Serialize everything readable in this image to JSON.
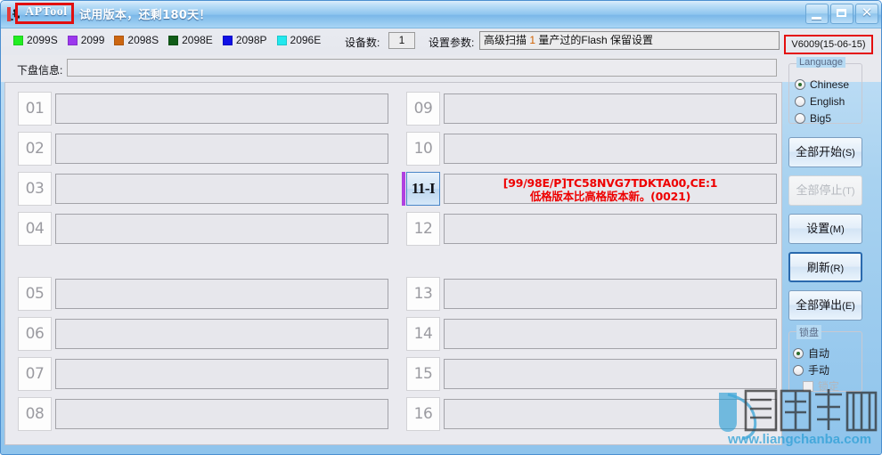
{
  "window": {
    "app_title": "APTool",
    "trial_text": "试用版本，还剩180天！",
    "app_icon": "usb-device-icon",
    "minimize_label": "–",
    "maximize_label": "□",
    "close_label": "✕"
  },
  "toolbar": {
    "legend": [
      {
        "label": "2099S",
        "color": "#22ee22"
      },
      {
        "label": "2099",
        "color": "#9c38ee"
      },
      {
        "label": "2098S",
        "color": "#cc6611"
      },
      {
        "label": "2098E",
        "color": "#105c18"
      },
      {
        "label": "2098P",
        "color": "#1010e6"
      },
      {
        "label": "2096E",
        "color": "#22e8ee"
      }
    ],
    "device_count_label": "设备数:",
    "device_count_value": "1",
    "param_label": "设置参数:",
    "param_value_pre": "高级扫描 ",
    "param_value_num": "1",
    "param_value_post": " 量产过的Flash 保留设置",
    "version": "V6009(15-06-15)"
  },
  "info_row": {
    "label": "下盘信息:",
    "value": ""
  },
  "slots": {
    "left": [
      {
        "num": "01",
        "value": "",
        "active": false,
        "message": ""
      },
      {
        "num": "02",
        "value": "",
        "active": false,
        "message": ""
      },
      {
        "num": "03",
        "value": "",
        "active": false,
        "message": ""
      },
      {
        "num": "04",
        "value": "",
        "active": false,
        "message": ""
      },
      {
        "num": "05",
        "value": "",
        "active": false,
        "message": ""
      },
      {
        "num": "06",
        "value": "",
        "active": false,
        "message": ""
      },
      {
        "num": "07",
        "value": "",
        "active": false,
        "message": ""
      },
      {
        "num": "08",
        "value": "",
        "active": false,
        "message": ""
      }
    ],
    "right": [
      {
        "num": "09",
        "value": "",
        "active": false,
        "message": ""
      },
      {
        "num": "10",
        "value": "",
        "active": false,
        "message": ""
      },
      {
        "num": "11-I",
        "value": "",
        "active": true,
        "bar_color": "#b041e0",
        "message_line1": "[99/98E/P]TC58NVG7TDKTA00,CE:1",
        "message_line2": "低格版本比高格版本新。(0021)"
      },
      {
        "num": "12",
        "value": "",
        "active": false,
        "message": ""
      },
      {
        "num": "13",
        "value": "",
        "active": false,
        "message": ""
      },
      {
        "num": "14",
        "value": "",
        "active": false,
        "message": ""
      },
      {
        "num": "15",
        "value": "",
        "active": false,
        "message": ""
      },
      {
        "num": "16",
        "value": "",
        "active": false,
        "message": ""
      }
    ]
  },
  "side": {
    "language_group": {
      "title": "Language",
      "options": [
        {
          "label": "Chinese",
          "checked": true
        },
        {
          "label": "English",
          "checked": false
        },
        {
          "label": "Big5",
          "checked": false
        }
      ]
    },
    "buttons": [
      {
        "label": "全部开始",
        "mnemonic": "(S)",
        "state": "enabled"
      },
      {
        "label": "全部停止",
        "mnemonic": "(T)",
        "state": "disabled"
      },
      {
        "label": "设置",
        "mnemonic": "(M)",
        "state": "enabled"
      },
      {
        "label": "刷新",
        "mnemonic": "(R)",
        "state": "focused"
      },
      {
        "label": "全部弹出",
        "mnemonic": "(E)",
        "state": "enabled"
      }
    ],
    "lock_group": {
      "title": "锁盘",
      "options": [
        {
          "label": "自动",
          "checked": true
        },
        {
          "label": "手动",
          "checked": false
        }
      ],
      "checkbox": {
        "label": "锁定",
        "checked": false,
        "disabled": true
      }
    }
  },
  "watermark": {
    "text_cn": "量产吧网",
    "url": "www.liangchanba.com"
  }
}
